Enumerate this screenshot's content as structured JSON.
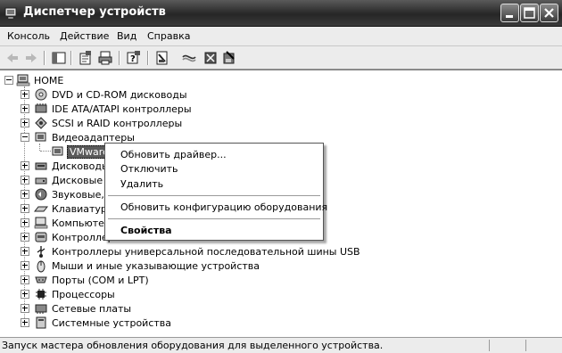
{
  "window": {
    "title": "Диспетчер устройств"
  },
  "menubar": {
    "items": [
      "Консоль",
      "Действие",
      "Вид",
      "Справка"
    ]
  },
  "tree": {
    "root": "HOME",
    "items": [
      "DVD и CD-ROM дисководы",
      "IDE ATA/ATAPI контроллеры",
      "SCSI и RAID контроллеры",
      "Видеоадаптеры",
      "VMware",
      "Дисководы",
      "Дисковые",
      "Звуковые,",
      "Клавиатур",
      "Компьютер",
      "Контроллер",
      "Контроллеры универсальной последовательной шины USB",
      "Мыши и иные указывающие устройства",
      "Порты (COM и LPT)",
      "Процессоры",
      "Сетевые платы",
      "Системные устройства"
    ]
  },
  "context_menu": {
    "items": [
      "Обновить драйвер...",
      "Отключить",
      "Удалить",
      "Обновить конфигурацию оборудования",
      "Свойства"
    ]
  },
  "statusbar": {
    "text": "Запуск мастера обновления оборудования для выделенного устройства."
  }
}
